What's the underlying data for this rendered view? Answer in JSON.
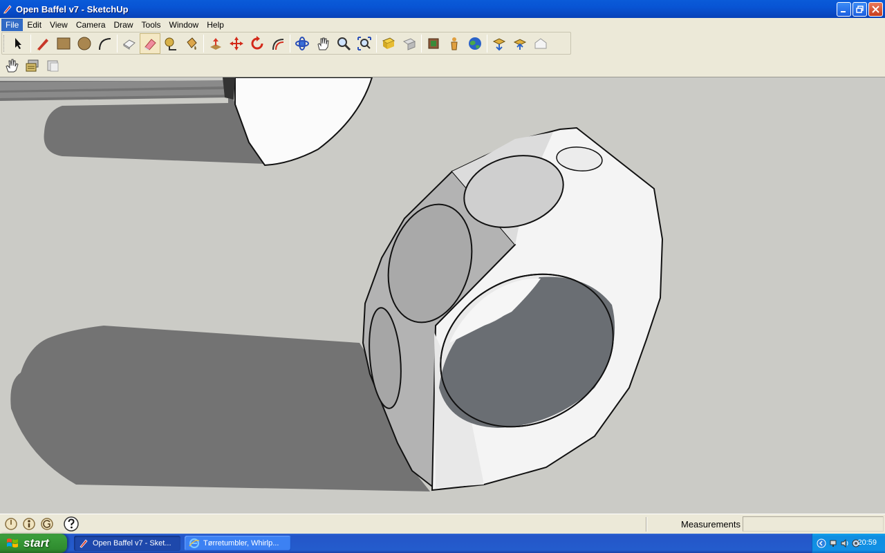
{
  "window": {
    "title": "Open Baffel v7 - SketchUp"
  },
  "menu": {
    "items": [
      "File",
      "Edit",
      "View",
      "Camera",
      "Draw",
      "Tools",
      "Window",
      "Help"
    ]
  },
  "toolbar": {
    "tools": [
      {
        "name": "select-icon"
      },
      {
        "name": "pencil-icon"
      },
      {
        "name": "rectangle-icon"
      },
      {
        "name": "circle-icon"
      },
      {
        "name": "arc-icon"
      },
      {
        "name": "make-component-icon"
      },
      {
        "name": "eraser-icon",
        "selected": true
      },
      {
        "name": "tape-measure-icon"
      },
      {
        "name": "paint-bucket-icon"
      },
      {
        "name": "push-pull-icon"
      },
      {
        "name": "move-icon"
      },
      {
        "name": "rotate-icon"
      },
      {
        "name": "offset-icon"
      },
      {
        "name": "orbit-icon"
      },
      {
        "name": "pan-icon"
      },
      {
        "name": "zoom-icon"
      },
      {
        "name": "zoom-extents-icon"
      },
      {
        "name": "get-models-icon"
      },
      {
        "name": "share-model-icon"
      },
      {
        "name": "place-model-icon"
      },
      {
        "name": "position-camera-icon"
      },
      {
        "name": "google-earth-icon"
      },
      {
        "name": "get-current-view-icon"
      },
      {
        "name": "toggle-terrain-icon"
      },
      {
        "name": "place-model-earth-icon"
      }
    ],
    "second_row": [
      {
        "name": "hand-icon"
      },
      {
        "name": "layer-manager-icon"
      },
      {
        "name": "components-icon"
      }
    ]
  },
  "status": {
    "measurements_label": "Measurements",
    "measurements_value": "",
    "message": ""
  },
  "taskbar": {
    "start_label": "start",
    "tasks": [
      {
        "label": "Open Baffel v7 - Sket...",
        "active": true
      },
      {
        "label": "Tørretumbler, Whirlp...",
        "active": false
      }
    ],
    "clock": "20:59"
  },
  "colors": {
    "viewport_bg": "#cbcbc6",
    "shadow": "#737373",
    "hole_inside": "#6a6e73",
    "titlebar": "#0854d4",
    "taskbar": "#245ccd",
    "start": "#3a9c3a"
  }
}
